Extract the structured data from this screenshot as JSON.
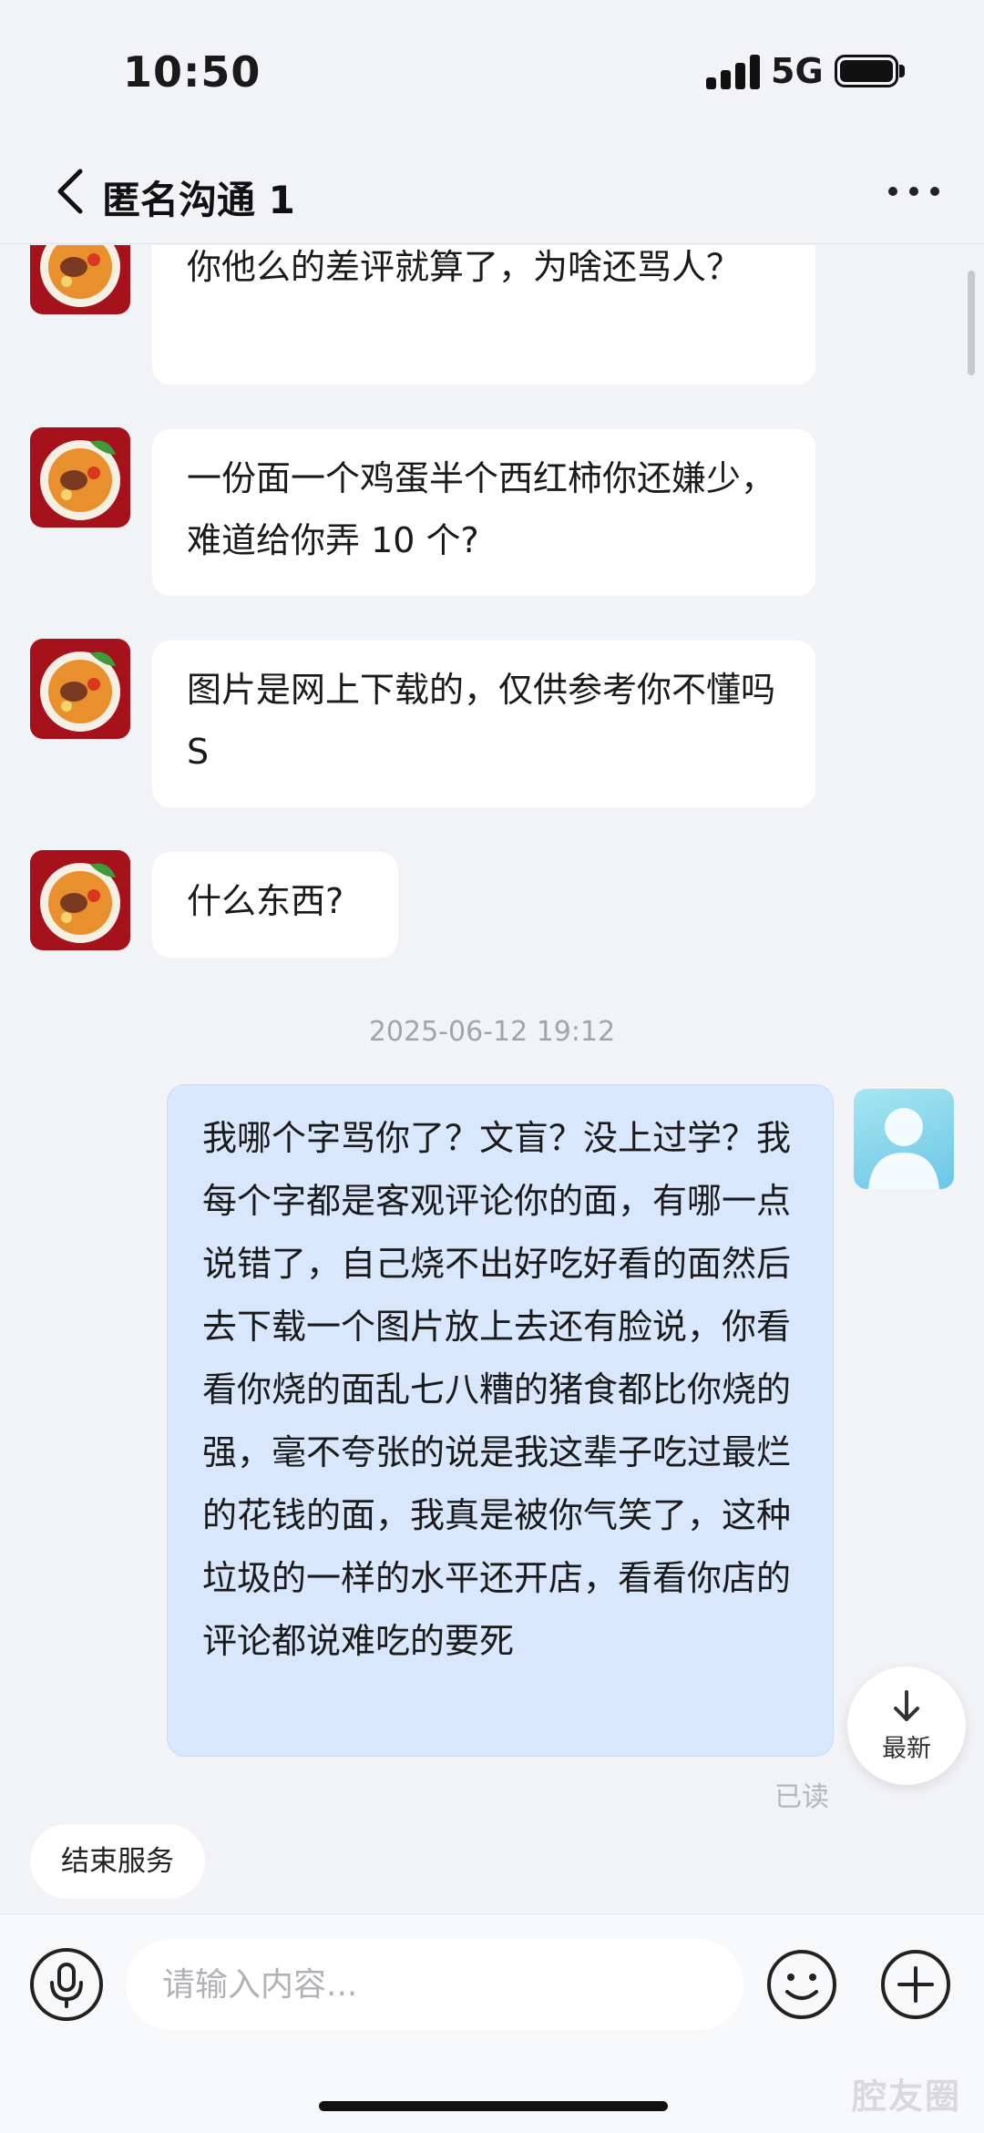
{
  "status_bar": {
    "time": "10:50",
    "network": "5G",
    "battery_percent": 100
  },
  "nav": {
    "title": "匿名沟通 1"
  },
  "messages": [
    {
      "from": "shop",
      "text": "你他么的差评就算了，为啥还骂人？"
    },
    {
      "from": "shop",
      "text": "一份面一个鸡蛋半个西红柿你还嫌少，难道给你弄 10 个?"
    },
    {
      "from": "shop",
      "text": "图片是网上下载的，仅供参考你不懂吗 S"
    },
    {
      "from": "shop",
      "text": "什么东西?"
    },
    {
      "from": "self",
      "text": "我哪个字骂你了？文盲？没上过学？我每个字都是客观评论你的面，有哪一点说错了，自己烧不出好吃好看的面然后去下载一个图片放上去还有脸说，你看看你烧的面乱七八糟的猪食都比你烧的强，毫不夸张的说是我这辈子吃过最烂的花钱的面，我真是被你气笑了，这种垃圾的一样的水平还开店，看看你店的评论都说难吃的要死"
    }
  ],
  "timestamp": "2025-06-12 19:12",
  "read_receipt": "已读",
  "latest_button": "最新",
  "end_service": "结束服务",
  "input": {
    "placeholder": "请输入内容..."
  },
  "watermark": "腔友圈",
  "icons": {
    "back": "chevron-left-icon",
    "more": "more-dots-icon",
    "mic": "microphone-icon",
    "emoji": "emoji-icon",
    "plus": "plus-icon",
    "down_arrow": "arrow-down-icon"
  }
}
